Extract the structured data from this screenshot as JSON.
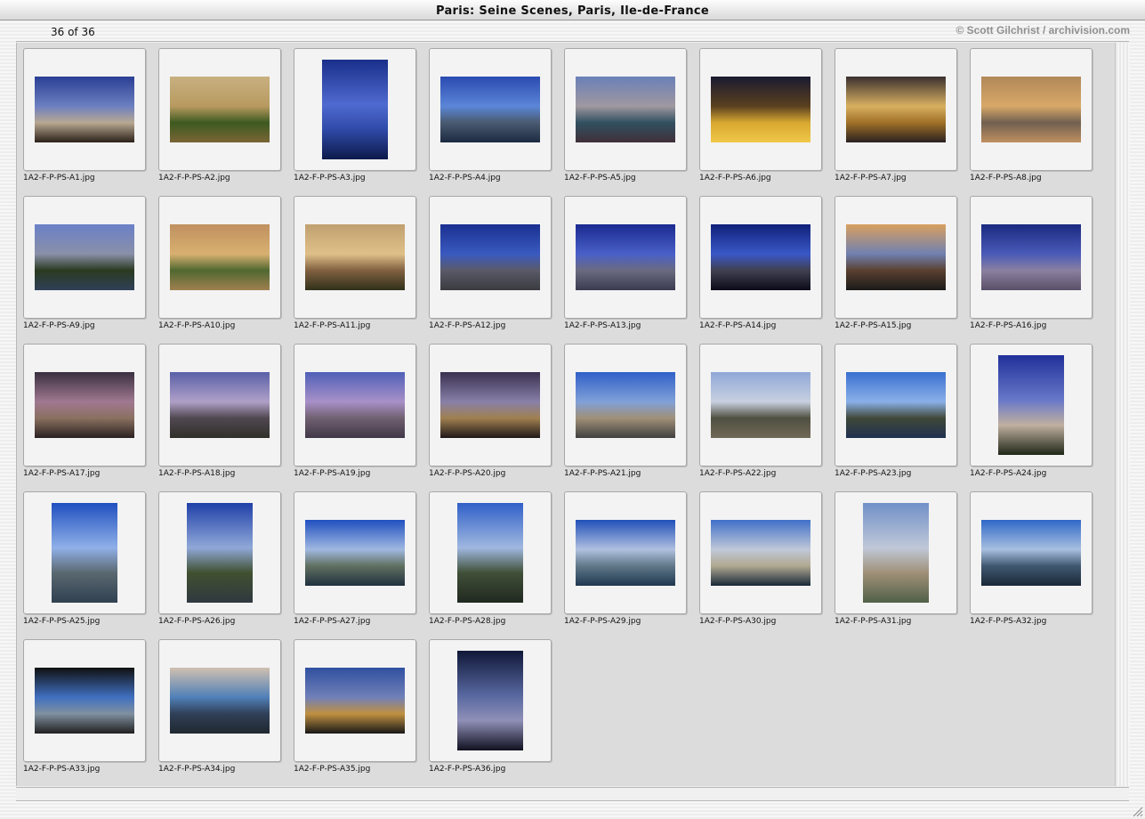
{
  "window": {
    "title": "Paris: Seine Scenes, Paris, Ile-de-France"
  },
  "header": {
    "count": "36 of 36",
    "credit": "© Scott Gilchrist / archivision.com"
  },
  "thumbnails": [
    {
      "label": "1A2-F-P-PS-A1.jpg",
      "orientation": "landscape",
      "colors": [
        "#2a3f95",
        "#6c7fc0",
        "#b8a892",
        "#2b2018"
      ]
    },
    {
      "label": "1A2-F-P-PS-A2.jpg",
      "orientation": "landscape",
      "colors": [
        "#c8b080",
        "#b89a60",
        "#3d5a20",
        "#7a6535"
      ]
    },
    {
      "label": "1A2-F-P-PS-A3.jpg",
      "orientation": "portrait",
      "colors": [
        "#1a2f8a",
        "#4f6ad0",
        "#2f4aa8",
        "#0d1a4a"
      ]
    },
    {
      "label": "1A2-F-P-PS-A4.jpg",
      "orientation": "landscape",
      "colors": [
        "#2a4ab0",
        "#5b86d8",
        "#4a5a70",
        "#1b2a40"
      ]
    },
    {
      "label": "1A2-F-P-PS-A5.jpg",
      "orientation": "landscape",
      "colors": [
        "#6a80b8",
        "#a098a0",
        "#305060",
        "#40303a"
      ]
    },
    {
      "label": "1A2-F-P-PS-A6.jpg",
      "orientation": "landscape",
      "colors": [
        "#1a1a30",
        "#5a4020",
        "#d8a830",
        "#f0c848"
      ]
    },
    {
      "label": "1A2-F-P-PS-A7.jpg",
      "orientation": "landscape",
      "colors": [
        "#3a3030",
        "#d8b060",
        "#a07028",
        "#2a2020"
      ]
    },
    {
      "label": "1A2-F-P-PS-A8.jpg",
      "orientation": "landscape",
      "colors": [
        "#b08858",
        "#d8a868",
        "#706050",
        "#c09060"
      ]
    },
    {
      "label": "1A2-F-P-PS-A9.jpg",
      "orientation": "landscape",
      "colors": [
        "#6a80c8",
        "#8a90a8",
        "#2a3a20",
        "#304058"
      ]
    },
    {
      "label": "1A2-F-P-PS-A10.jpg",
      "orientation": "landscape",
      "colors": [
        "#c09060",
        "#d8b070",
        "#506830",
        "#a08050"
      ]
    },
    {
      "label": "1A2-F-P-PS-A11.jpg",
      "orientation": "landscape",
      "colors": [
        "#c0a070",
        "#e0c088",
        "#806040",
        "#30301a"
      ]
    },
    {
      "label": "1A2-F-P-PS-A12.jpg",
      "orientation": "landscape",
      "colors": [
        "#1a3090",
        "#3a5ac0",
        "#5a5a68",
        "#3a3a40"
      ]
    },
    {
      "label": "1A2-F-P-PS-A13.jpg",
      "orientation": "landscape",
      "colors": [
        "#1a2a90",
        "#4a60c8",
        "#6a6a80",
        "#3a3a50"
      ]
    },
    {
      "label": "1A2-F-P-PS-A14.jpg",
      "orientation": "landscape",
      "colors": [
        "#10207a",
        "#3a58c8",
        "#404050",
        "#0a0a18"
      ]
    },
    {
      "label": "1A2-F-P-PS-A15.jpg",
      "orientation": "landscape",
      "colors": [
        "#d8a060",
        "#7080b0",
        "#5a4030",
        "#1a1a1a"
      ]
    },
    {
      "label": "1A2-F-P-PS-A16.jpg",
      "orientation": "landscape",
      "colors": [
        "#1a2a80",
        "#4a5ab8",
        "#8a80a0",
        "#5a5068"
      ]
    },
    {
      "label": "1A2-F-P-PS-A17.jpg",
      "orientation": "landscape",
      "colors": [
        "#3a3040",
        "#a07890",
        "#8a7060",
        "#2a2020"
      ]
    },
    {
      "label": "1A2-F-P-PS-A18.jpg",
      "orientation": "landscape",
      "colors": [
        "#5a60a8",
        "#b0a0c8",
        "#504850",
        "#30302a"
      ]
    },
    {
      "label": "1A2-F-P-PS-A19.jpg",
      "orientation": "landscape",
      "colors": [
        "#5060b8",
        "#a890c8",
        "#706070",
        "#403848"
      ]
    },
    {
      "label": "1A2-F-P-PS-A20.jpg",
      "orientation": "landscape",
      "colors": [
        "#3a3050",
        "#8880a8",
        "#a08050",
        "#201818"
      ]
    },
    {
      "label": "1A2-F-P-PS-A21.jpg",
      "orientation": "landscape",
      "colors": [
        "#3060c8",
        "#80a0d8",
        "#a09078",
        "#404040"
      ]
    },
    {
      "label": "1A2-F-P-PS-A22.jpg",
      "orientation": "landscape",
      "colors": [
        "#90a8d8",
        "#c8d0e0",
        "#505040",
        "#706858"
      ]
    },
    {
      "label": "1A2-F-P-PS-A23.jpg",
      "orientation": "landscape",
      "colors": [
        "#3a70d0",
        "#8ab0e8",
        "#404838",
        "#203050"
      ]
    },
    {
      "label": "1A2-F-P-PS-A24.jpg",
      "orientation": "portrait",
      "colors": [
        "#20309a",
        "#6878c8",
        "#c0b0a0",
        "#202818"
      ]
    },
    {
      "label": "1A2-F-P-PS-A25.jpg",
      "orientation": "portrait",
      "colors": [
        "#2050c0",
        "#90b0e8",
        "#5a6870",
        "#304050"
      ]
    },
    {
      "label": "1A2-F-P-PS-A26.jpg",
      "orientation": "portrait",
      "colors": [
        "#2040a8",
        "#90a8d8",
        "#405030",
        "#303840"
      ]
    },
    {
      "label": "1A2-F-P-PS-A27.jpg",
      "orientation": "landscape",
      "colors": [
        "#2050c0",
        "#a0b8e0",
        "#607060",
        "#203040"
      ]
    },
    {
      "label": "1A2-F-P-PS-A28.jpg",
      "orientation": "portrait",
      "colors": [
        "#3060c8",
        "#a0b8e0",
        "#405038",
        "#202820"
      ]
    },
    {
      "label": "1A2-F-P-PS-A29.jpg",
      "orientation": "landscape",
      "colors": [
        "#2050b8",
        "#b0c0e0",
        "#607888",
        "#203850"
      ]
    },
    {
      "label": "1A2-F-P-PS-A30.jpg",
      "orientation": "landscape",
      "colors": [
        "#4070c8",
        "#c0c8d8",
        "#b0a890",
        "#182838"
      ]
    },
    {
      "label": "1A2-F-P-PS-A31.jpg",
      "orientation": "portrait",
      "colors": [
        "#7090c8",
        "#c0c8d8",
        "#a09078",
        "#506048"
      ]
    },
    {
      "label": "1A2-F-P-PS-A32.jpg",
      "orientation": "landscape",
      "colors": [
        "#3068c8",
        "#a8c0e0",
        "#405870",
        "#1a2838"
      ]
    },
    {
      "label": "1A2-F-P-PS-A33.jpg",
      "orientation": "landscape",
      "colors": [
        "#101010",
        "#4070c0",
        "#8090a0",
        "#202020"
      ]
    },
    {
      "label": "1A2-F-P-PS-A34.jpg",
      "orientation": "landscape",
      "colors": [
        "#d0c0b0",
        "#5080b8",
        "#304058",
        "#202830"
      ]
    },
    {
      "label": "1A2-F-P-PS-A35.jpg",
      "orientation": "landscape",
      "colors": [
        "#3050a0",
        "#7080b8",
        "#c09040",
        "#181818"
      ]
    },
    {
      "label": "1A2-F-P-PS-A36.jpg",
      "orientation": "portrait",
      "colors": [
        "#101838",
        "#5868a0",
        "#9090b8",
        "#101020"
      ]
    }
  ]
}
